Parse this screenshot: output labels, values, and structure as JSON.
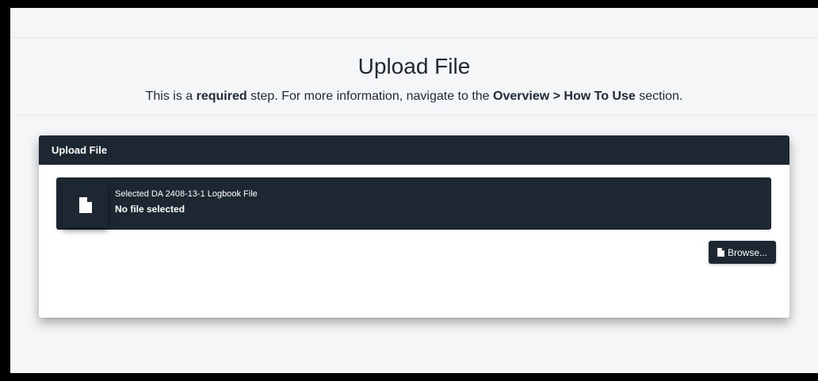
{
  "page": {
    "title": "Upload File",
    "subtitle_pre": "This is a ",
    "subtitle_bold1": "required",
    "subtitle_mid": " step. For more information, navigate to the ",
    "subtitle_bold2": "Overview > How To Use",
    "subtitle_post": " section."
  },
  "card": {
    "header": "Upload File",
    "file_label": "Selected DA 2408-13-1 Logbook File",
    "file_status": "No file selected",
    "browse_label": "Browse..."
  },
  "icons": {
    "file": "file-icon",
    "browse": "file-icon"
  },
  "colors": {
    "dark": "#1c2732",
    "background": "#f5f6f8"
  }
}
